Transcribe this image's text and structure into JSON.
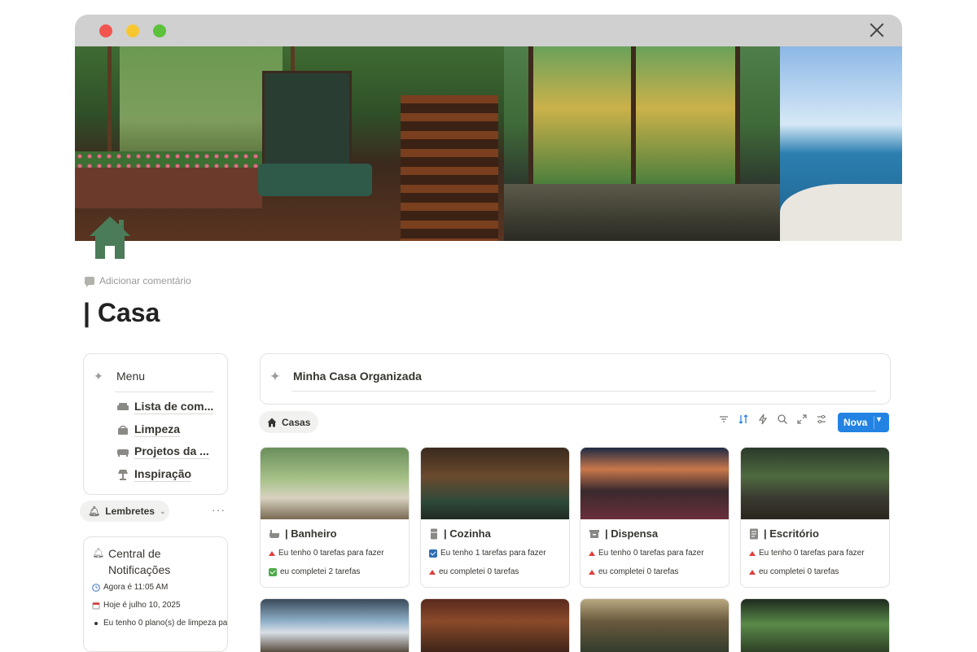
{
  "window": {
    "close_icon": "close-icon",
    "dots": [
      "#f2544f",
      "#f7c731",
      "#5cc13b"
    ]
  },
  "page": {
    "icon": "house-icon",
    "icon_color": "#4a7c59",
    "add_comment": "Adicionar comentário",
    "title": "| Casa"
  },
  "menu": {
    "title": "Menu",
    "items": [
      {
        "label": "Lista de com...",
        "icon": "sofa-icon"
      },
      {
        "label": "Limpeza",
        "icon": "basket-icon"
      },
      {
        "label": "Projetos da ...",
        "icon": "couch-icon"
      },
      {
        "label": "Inspiração",
        "icon": "lamp-icon"
      }
    ]
  },
  "reminders": {
    "label": "Lembretes",
    "more": "···"
  },
  "notifications": {
    "title": "Central de Notificações",
    "lines": [
      {
        "icon": "clock-icon",
        "text": "Agora é 11:05 AM"
      },
      {
        "icon": "calendar-icon",
        "text": "Hoje é julho 10, 2025"
      },
      {
        "icon": "bullet-icon",
        "text": "Eu tenho 0 plano(s) de limpeza pa"
      }
    ]
  },
  "banner": {
    "title": "Minha Casa Organizada"
  },
  "view": {
    "tab": "Casas",
    "new_button": "Nova"
  },
  "colors": {
    "accent": "#2383e2",
    "alert": "#e03e3e",
    "done": "#4dab4a"
  },
  "cards": [
    {
      "title": "| Banheiro",
      "icon": "bathtub-icon",
      "line1": "Eu tenho 0 tarefas para fazer",
      "line1_state": "alert",
      "line2": "eu completei 2 tarefas",
      "line2_state": "done"
    },
    {
      "title": "| Cozinha",
      "icon": "fridge-icon",
      "line1": "Eu tenho 1 tarefas para fazer",
      "line1_state": "checked",
      "line2": "eu completei 0 tarefas",
      "line2_state": "alert"
    },
    {
      "title": "| Dispensa",
      "icon": "box-icon",
      "line1": "Eu tenho 0 tarefas para fazer",
      "line1_state": "alert",
      "line2": "eu completei 0 tarefas",
      "line2_state": "alert"
    },
    {
      "title": "| Escritório",
      "icon": "document-icon",
      "line1": "Eu tenho 0 tarefas para fazer",
      "line1_state": "alert",
      "line2": "eu completei 0 tarefas",
      "line2_state": "alert"
    }
  ]
}
